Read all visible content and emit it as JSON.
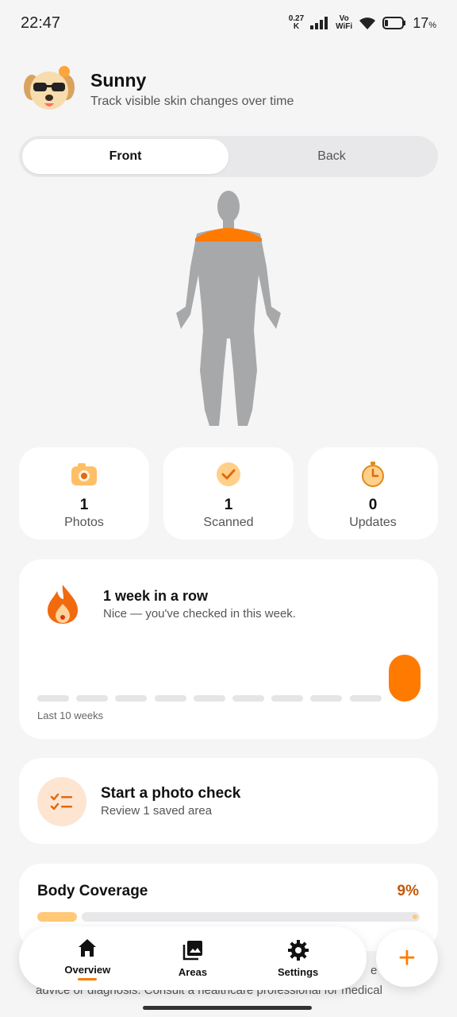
{
  "status_bar": {
    "time": "22:47",
    "net_speed_value": "0.27",
    "net_speed_unit": "K",
    "volte": "Vo",
    "volte_sub": "WiFi",
    "battery": "17",
    "battery_unit": "%"
  },
  "header": {
    "title": "Sunny",
    "subtitle": "Track visible skin changes over time"
  },
  "view_toggle": {
    "front_label": "Front",
    "back_label": "Back",
    "selected": "Front"
  },
  "body_map": {
    "highlighted_area": "shoulders",
    "highlight_color": "#ff7a00"
  },
  "stats": [
    {
      "icon": "camera-icon",
      "value": "1",
      "label": "Photos"
    },
    {
      "icon": "check-badge-icon",
      "value": "1",
      "label": "Scanned"
    },
    {
      "icon": "timer-icon",
      "value": "0",
      "label": "Updates"
    }
  ],
  "streak": {
    "title": "1 week in a row",
    "subtitle": "Nice — you've checked in this week.",
    "weeks_label": "Last 10 weeks",
    "weeks_checked": [
      false,
      false,
      false,
      false,
      false,
      false,
      false,
      false,
      false,
      true
    ]
  },
  "photo_check": {
    "title": "Start a photo check",
    "subtitle": "Review 1 saved area"
  },
  "coverage": {
    "title": "Body Coverage",
    "percent": "9%",
    "fraction": 0.09
  },
  "disclaimer": {
    "fragment": "e n",
    "line": "advice or diagnosis. Consult a healthcare professional for medical"
  },
  "nav": {
    "overview": "Overview",
    "areas": "Areas",
    "settings": "Settings",
    "fab": "+"
  },
  "colors": {
    "accent": "#ff7a00",
    "coverage_fill": "#ffc978",
    "background": "#f5f5f5"
  }
}
